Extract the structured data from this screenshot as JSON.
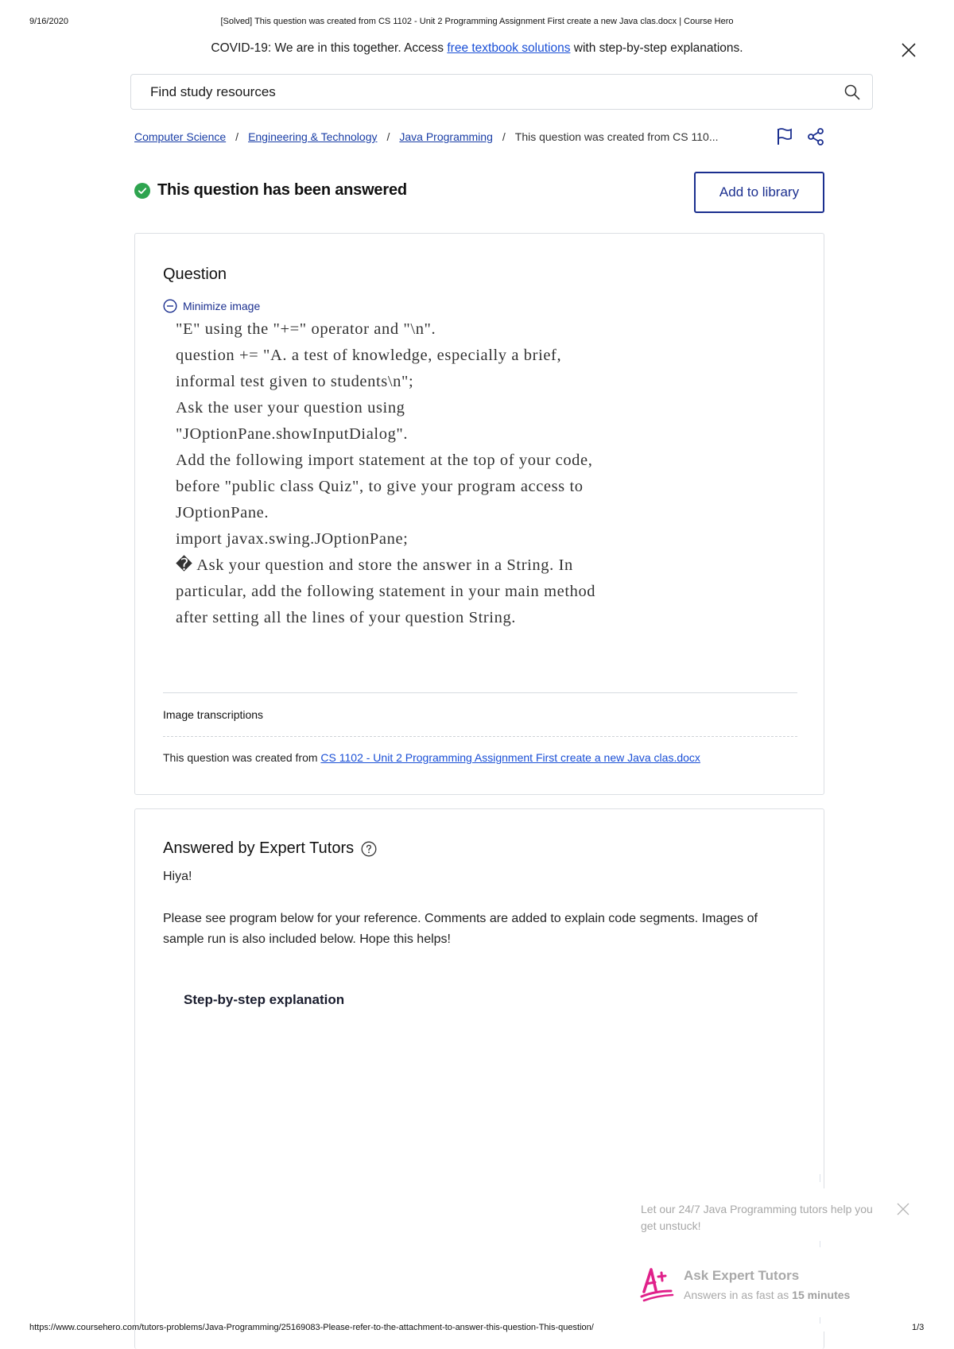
{
  "print_header": {
    "date": "9/16/2020",
    "title": "[Solved] This question was created from CS 1102 - Unit 2 Programming Assignment First create a new Java clas.docx | Course Hero"
  },
  "banner": {
    "text_before": "COVID-19: We are in this together. Access ",
    "link_text": "free textbook solutions",
    "text_after": " with step-by-step explanations.",
    "close_icon": "close-icon"
  },
  "search": {
    "placeholder": "Find study resources",
    "value": "",
    "icon": "search-icon"
  },
  "breadcrumb": {
    "items": [
      "Computer Science",
      "Engineering & Technology",
      "Java Programming"
    ],
    "current": "This question was created from CS 110...",
    "separator": "/"
  },
  "actions": {
    "flag_icon": "flag-icon",
    "share_icon": "share-icon"
  },
  "status": {
    "title": "This question has been answered",
    "icon": "check-circle-icon",
    "color": "#2ea44f"
  },
  "add_to_library": "Add to library",
  "question": {
    "heading": "Question",
    "minimize_label": "Minimize image",
    "image_lines": [
      "\"E\" using the \"+=\" operator and \"\\n\".",
      "question += \"A. a test of knowledge, especially a brief,",
      "informal test given to students\\n\";",
      "Ask the user your question using",
      "\"JOptionPane.showInputDialog\".",
      "Add the following import statement at the top of your code,",
      "before \"public class Quiz\", to give your program access to",
      "JOptionPane.",
      "import javax.swing.JOptionPane;",
      "� Ask your question and store the answer in a String. In",
      "particular, add the following statement in your main method",
      "after setting all the lines of your question String."
    ],
    "transcriptions_label": "Image transcriptions",
    "created_from_text": "This question was created from ",
    "created_from_link": "CS 1102 - Unit 2 Programming Assignment First create a new Java clas.docx"
  },
  "answer": {
    "heading": "Answered by Expert Tutors",
    "greeting": "Hiya!",
    "body": "Please see program below for your reference. Comments are added to explain code segments. Images of sample run is also included below. Hope this helps!",
    "step_title": "Step-by-step explanation"
  },
  "tutor_popup": {
    "message": "Let our 24/7 Java Programming tutors help you get unstuck!",
    "cta": "Ask Expert Tutors",
    "sub_prefix": "Answers in as fast as ",
    "sub_bold": "15 minutes",
    "accent": "#e0218a"
  },
  "print_footer": {
    "url": "https://www.coursehero.com/tutors-problems/Java-Programming/25169083-Please-refer-to-the-attachment-to-answer-this-question-This-question/",
    "page": "1/3"
  },
  "colors": {
    "link": "#1a4fd6",
    "brand_navy": "#1b2f8f",
    "success": "#2ea44f"
  }
}
